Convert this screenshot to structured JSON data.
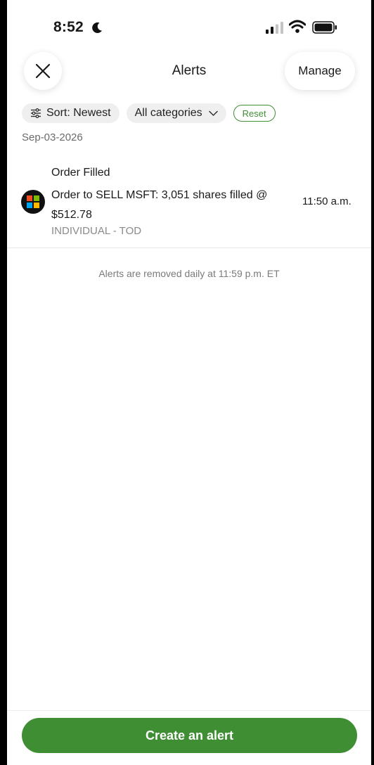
{
  "status_bar": {
    "time": "8:52",
    "icons": [
      "moon-icon",
      "signal-icon",
      "wifi-icon",
      "battery-icon"
    ]
  },
  "header": {
    "title": "Alerts",
    "close_icon": "close-icon",
    "manage_label": "Manage"
  },
  "filters": {
    "sort_label": "Sort: Newest",
    "category_label": "All categories",
    "reset_label": "Reset"
  },
  "alerts": {
    "date": "Sep-03-2026",
    "items": [
      {
        "title": "Order Filled",
        "message": "Order to SELL MSFT: 3,051 shares filled @ $512.78",
        "account": "INDIVIDUAL - TOD",
        "time": "11:50 a.m.",
        "logo": "microsoft-logo"
      }
    ]
  },
  "footer_note": "Alerts are removed daily at 11:59 p.m. ET",
  "actions": {
    "create_label": "Create an alert"
  },
  "colors": {
    "accent": "#3f8e34",
    "chip_bg": "#efefef",
    "muted_text": "#7a7a7a"
  }
}
